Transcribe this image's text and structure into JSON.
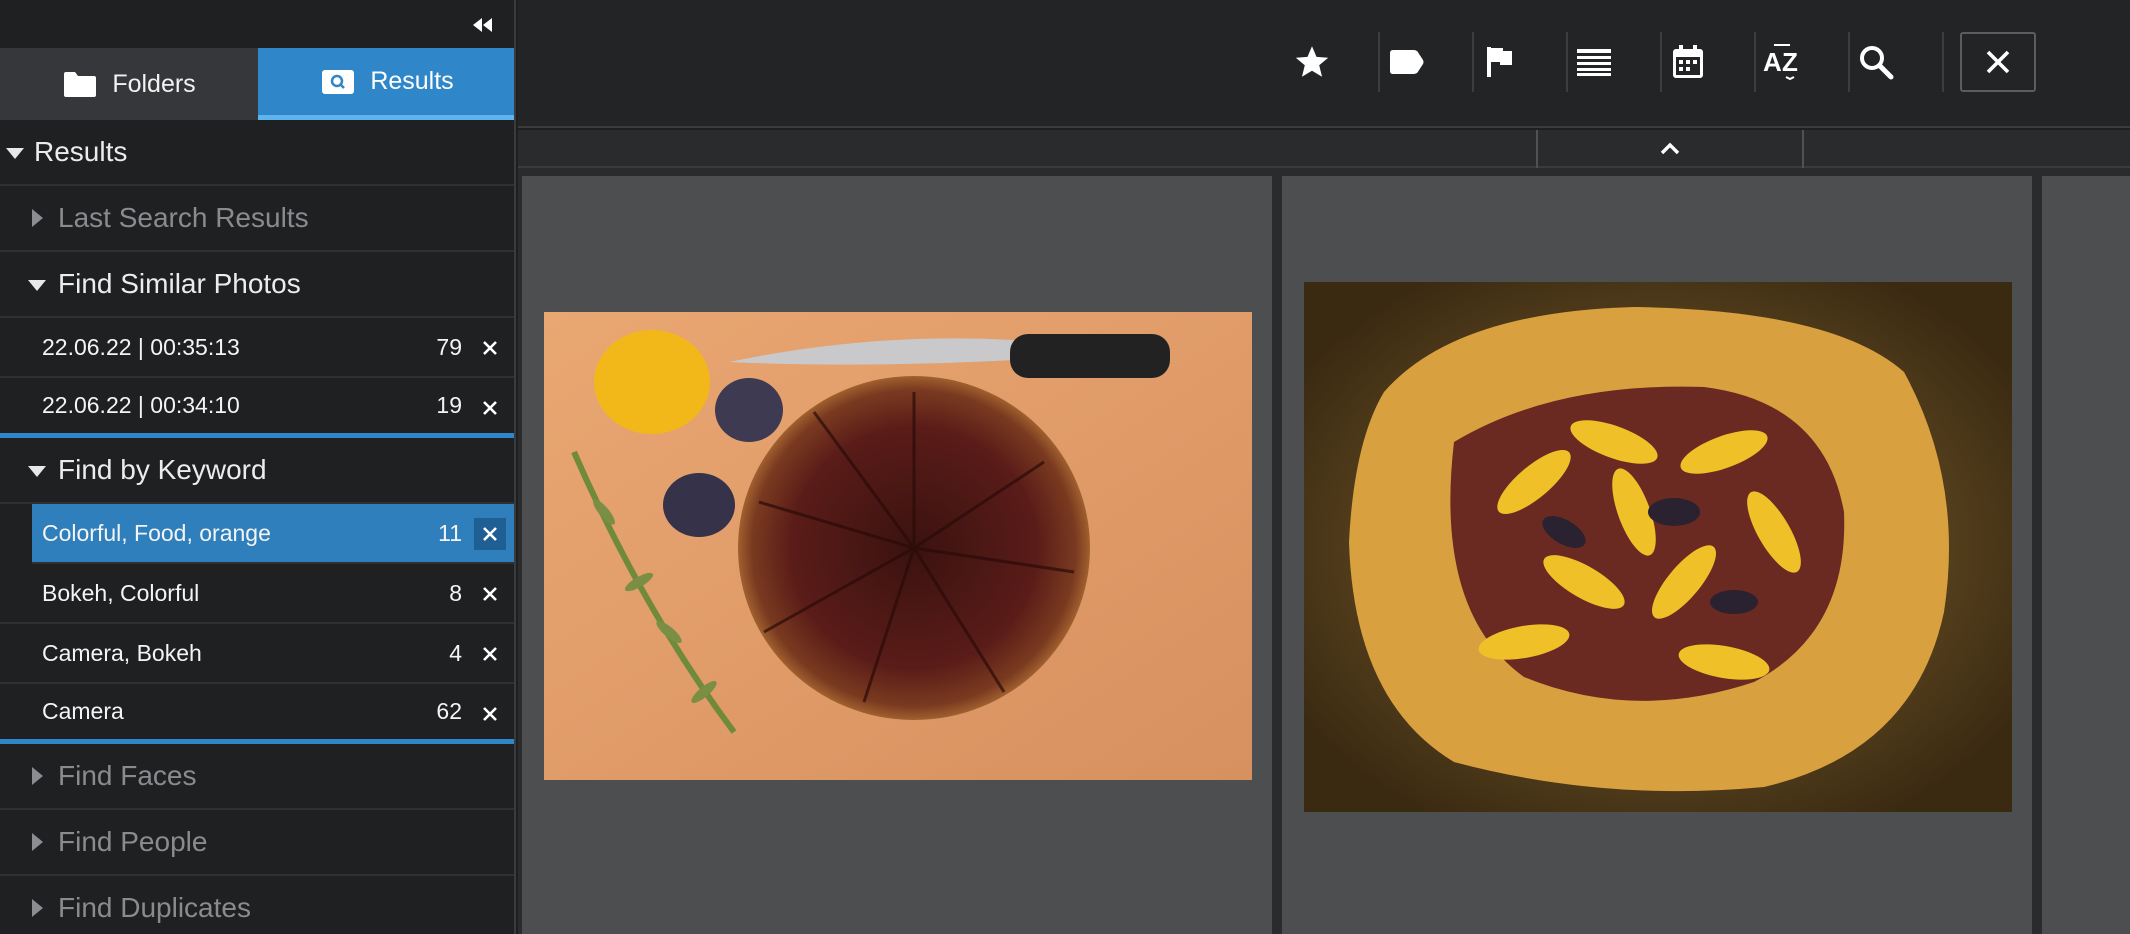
{
  "sidebar": {
    "tabs": [
      {
        "label": "Folders",
        "icon": "folder-icon"
      },
      {
        "label": "Results",
        "icon": "search-results-icon"
      }
    ],
    "root": {
      "label": "Results"
    },
    "last_search": {
      "label": "Last Search Results"
    },
    "find_similar": {
      "label": "Find Similar Photos",
      "items": [
        {
          "label": "22.06.22 | 00:35:13",
          "count": "79"
        },
        {
          "label": "22.06.22 | 00:34:10",
          "count": "19"
        }
      ]
    },
    "find_keyword": {
      "label": "Find by Keyword",
      "items": [
        {
          "label": "Colorful, Food, orange",
          "count": "11"
        },
        {
          "label": "Bokeh, Colorful",
          "count": "8"
        },
        {
          "label": "Camera, Bokeh",
          "count": "4"
        },
        {
          "label": "Camera",
          "count": "62"
        }
      ]
    },
    "find_faces": {
      "label": "Find Faces"
    },
    "find_people": {
      "label": "Find People"
    },
    "find_duplicates": {
      "label": "Find Duplicates"
    }
  },
  "toolbar": {
    "buttons": [
      "star-icon",
      "label-tag-icon",
      "flag-icon",
      "list-view-icon",
      "calendar-icon",
      "sort-az-icon",
      "search-icon"
    ],
    "close": "close-icon"
  },
  "colors": {
    "accent": "#2f86c8",
    "selected_row": "#2f7fbd",
    "cell_bg": "#4d4e50"
  }
}
